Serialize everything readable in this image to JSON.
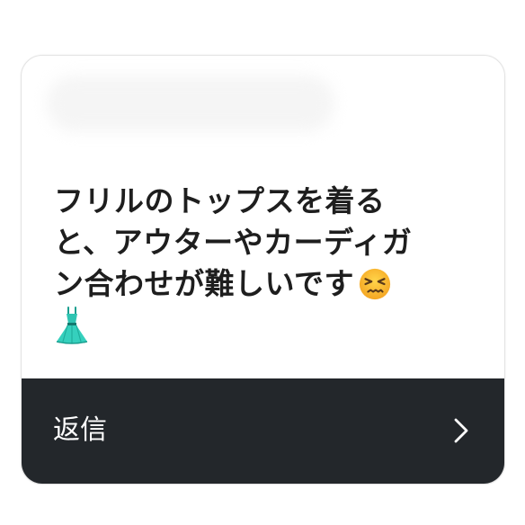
{
  "card": {
    "message_lines": [
      "フリルのトップスを着る",
      "と、アウターやカーディガ",
      "ン合わせが難しいです"
    ],
    "face_emoji_icon": "persevering-face-icon",
    "dress_emoji_icon": "dress-icon"
  },
  "footer": {
    "reply_label": "返信",
    "chevron_icon": "chevron-right-icon",
    "background_color": "#23272b"
  }
}
